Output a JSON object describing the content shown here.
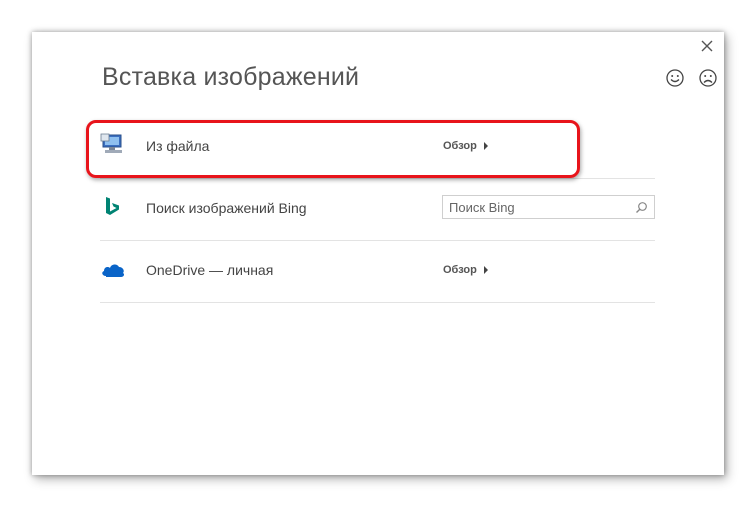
{
  "dialog": {
    "title": "Вставка изображений",
    "close_icon": "close-icon",
    "feedback": {
      "smile_icon": "smile-icon",
      "frown_icon": "frown-icon"
    }
  },
  "sources": [
    {
      "label": "Из файла",
      "action_label": "Обзор",
      "icon": "computer-icon"
    },
    {
      "label": "Поиск изображений Bing",
      "search_placeholder": "Поиск Bing",
      "search_value": "",
      "icon": "bing-icon"
    },
    {
      "label": "OneDrive — личная",
      "action_label": "Обзор",
      "icon": "onedrive-icon"
    }
  ],
  "colors": {
    "highlight": "#e8141b",
    "bing": "#008373",
    "onedrive": "#0a64c8"
  }
}
